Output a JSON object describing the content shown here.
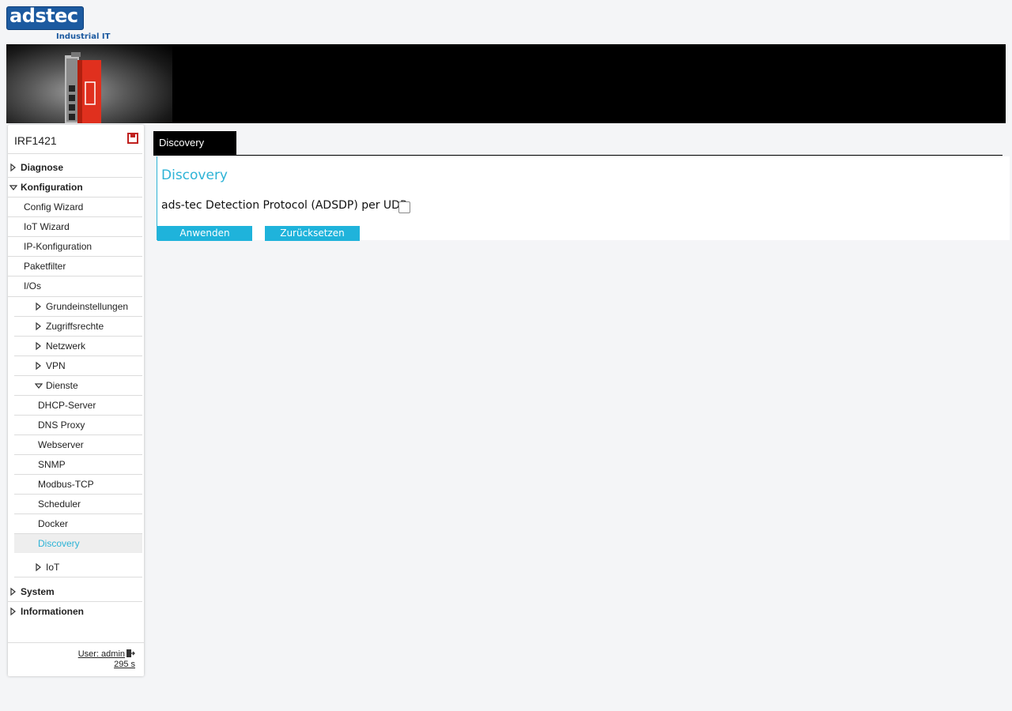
{
  "logo": {
    "text": "adstec",
    "subtitle": "Industrial IT"
  },
  "sidebar": {
    "device": "IRF1421",
    "menu": [
      {
        "label": "Diagnose"
      },
      {
        "label": "Konfiguration"
      },
      {
        "label": "Config Wizard"
      },
      {
        "label": "IoT Wizard"
      },
      {
        "label": "IP-Konfiguration"
      },
      {
        "label": "Paketfilter"
      },
      {
        "label": "I/Os"
      },
      {
        "label": "Grundeinstellungen"
      },
      {
        "label": "Zugriffsrechte"
      },
      {
        "label": "Netzwerk"
      },
      {
        "label": "VPN"
      },
      {
        "label": "Dienste"
      },
      {
        "label": "DHCP-Server"
      },
      {
        "label": "DNS Proxy"
      },
      {
        "label": "Webserver"
      },
      {
        "label": "SNMP"
      },
      {
        "label": "Modbus-TCP"
      },
      {
        "label": "Scheduler"
      },
      {
        "label": "Docker"
      },
      {
        "label": "Discovery"
      },
      {
        "label": "IoT"
      },
      {
        "label": "System"
      },
      {
        "label": "Informationen"
      }
    ],
    "user": "User: admin",
    "timer": "295 s"
  },
  "tab": {
    "label": "Discovery"
  },
  "content": {
    "title": "Discovery",
    "field_label": "ads-tec Detection Protocol (ADSDP) per UDP:",
    "checkbox_checked": false,
    "apply_label": "Anwenden",
    "reset_label": "Zurücksetzen"
  },
  "colors": {
    "accent": "#2db3d6",
    "button": "#1fb3db",
    "brand": "#1c5aa0"
  }
}
